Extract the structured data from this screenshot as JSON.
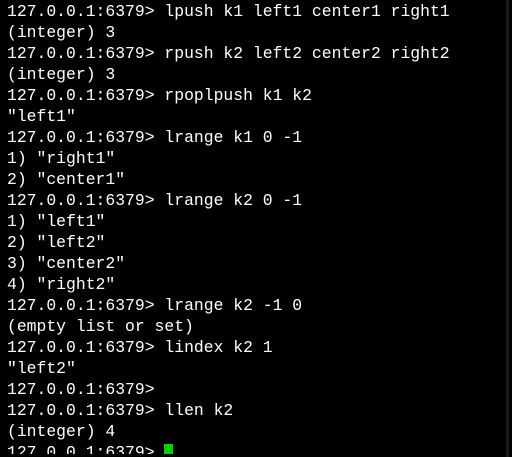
{
  "terminal": {
    "prompt": "127.0.0.1:6379>",
    "lines": [
      {
        "type": "cmd",
        "text": "lpush k1 left1 center1 right1"
      },
      {
        "type": "out",
        "text": "(integer) 3"
      },
      {
        "type": "cmd",
        "text": "rpush k2 left2 center2 right2"
      },
      {
        "type": "out",
        "text": "(integer) 3"
      },
      {
        "type": "cmd",
        "text": "rpoplpush k1 k2"
      },
      {
        "type": "out",
        "text": "\"left1\""
      },
      {
        "type": "cmd",
        "text": "lrange k1 0 -1"
      },
      {
        "type": "out",
        "text": "1) \"right1\""
      },
      {
        "type": "out",
        "text": "2) \"center1\""
      },
      {
        "type": "cmd",
        "text": "lrange k2 0 -1"
      },
      {
        "type": "out",
        "text": "1) \"left1\""
      },
      {
        "type": "out",
        "text": "2) \"left2\""
      },
      {
        "type": "out",
        "text": "3) \"center2\""
      },
      {
        "type": "out",
        "text": "4) \"right2\""
      },
      {
        "type": "cmd",
        "text": "lrange k2 -1 0"
      },
      {
        "type": "out",
        "text": "(empty list or set)"
      },
      {
        "type": "cmd",
        "text": "lindex k2 1"
      },
      {
        "type": "out",
        "text": "\"left2\""
      },
      {
        "type": "cmd",
        "text": ""
      },
      {
        "type": "cmd",
        "text": "llen k2"
      },
      {
        "type": "out",
        "text": "(integer) 4"
      }
    ],
    "active_prompt": "127.0.0.1:6379>",
    "cursor_color": "#00d400",
    "text_color": "#ffffff",
    "background_color": "#000000"
  }
}
